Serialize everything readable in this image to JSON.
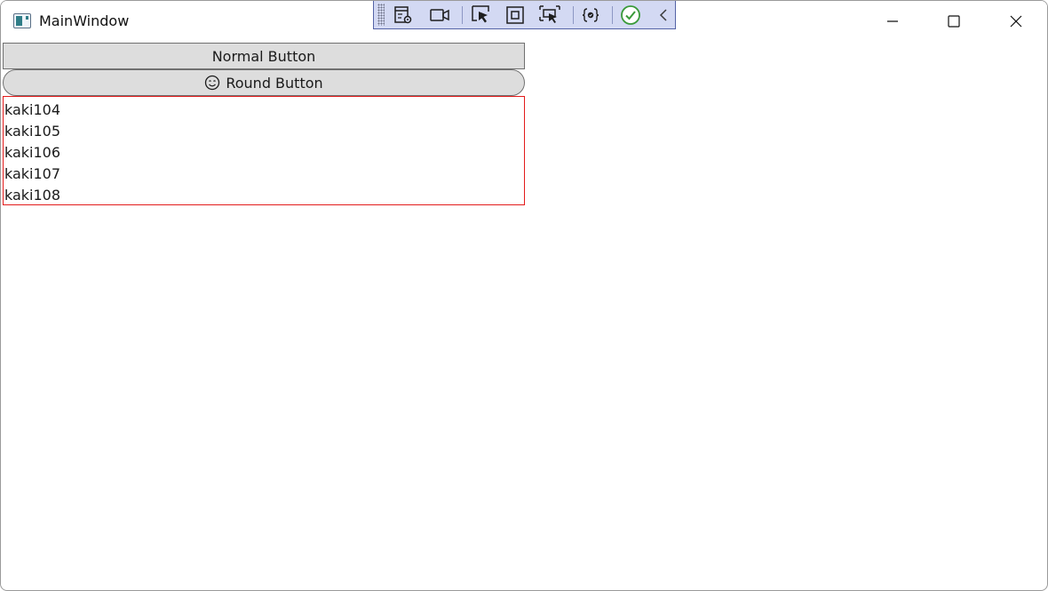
{
  "window": {
    "title": "MainWindow",
    "controls": {
      "minimize": "minimize-icon",
      "maximize": "maximize-icon",
      "close": "close-icon"
    }
  },
  "debug_toolbar": {
    "tools": [
      "live-visual-tree-icon",
      "record-icon",
      "select-element-icon",
      "display-layout-adorners-icon",
      "track-focus-icon",
      "binding-failures-icon",
      "accessibility-check-icon",
      "collapse-icon"
    ]
  },
  "buttons": {
    "normal_label": "Normal Button",
    "round_label": "Round Button",
    "round_icon": "smiley-icon"
  },
  "list": {
    "items": [
      "kaki104",
      "kaki105",
      "kaki106",
      "kaki107",
      "kaki108"
    ],
    "border_color": "#e31b1b"
  },
  "colors": {
    "toolbar_bg": "#d3d9f3",
    "toolbar_border": "#5463a6",
    "button_bg": "#dddddd"
  }
}
